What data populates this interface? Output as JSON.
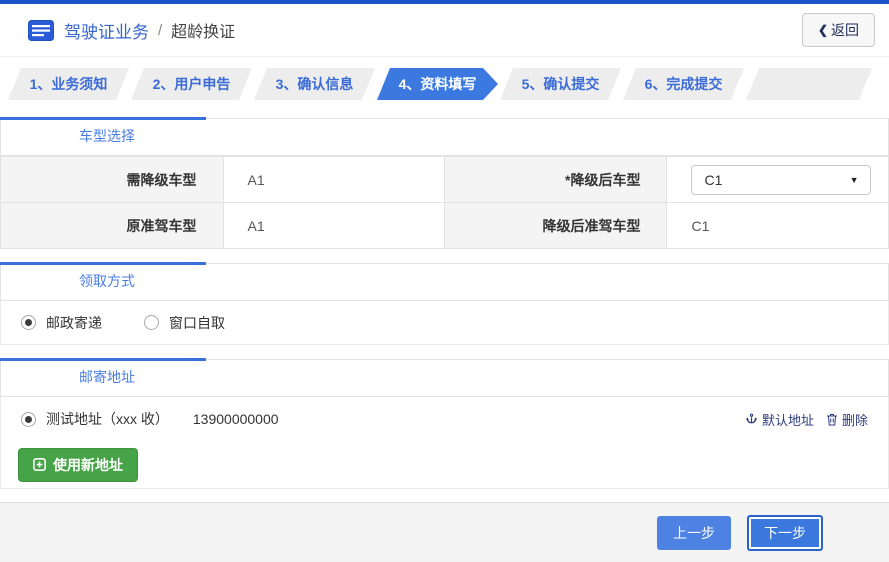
{
  "header": {
    "title": "驾驶证业务",
    "separator": "/",
    "subtitle": "超龄换证",
    "back": {
      "chevron": "❮",
      "label": "返回"
    }
  },
  "steps": [
    {
      "label": "1、业务须知",
      "active": false
    },
    {
      "label": "2、用户申告",
      "active": false
    },
    {
      "label": "3、确认信息",
      "active": false
    },
    {
      "label": "4、资料填写",
      "active": true
    },
    {
      "label": "5、确认提交",
      "active": false
    },
    {
      "label": "6、完成提交",
      "active": false
    }
  ],
  "vehicle_section": {
    "title": "车型选择",
    "row1": {
      "label1": "需降级车型",
      "value1": "A1",
      "label2": "*降级后车型",
      "select": {
        "value": "C1",
        "arrow": "▼"
      }
    },
    "row2": {
      "label1": "原准驾车型",
      "value1": "A1",
      "label2": "降级后准驾车型",
      "value2": "C1"
    }
  },
  "pickup_section": {
    "title": "领取方式",
    "options": [
      {
        "label": "邮政寄递",
        "selected": true
      },
      {
        "label": "窗口自取",
        "selected": false
      }
    ]
  },
  "address_section": {
    "title": "邮寄地址",
    "address": {
      "selected": true,
      "name": "测试地址（xxx 收）",
      "phone": "13900000000"
    },
    "links": {
      "default_label": "默认地址",
      "delete_label": "删除"
    },
    "new_address_label": "使用新地址"
  },
  "footer": {
    "prev_label": "上一步",
    "next_label": "下一步"
  },
  "colors": {
    "topbar_blue": "#1d53c6",
    "step_active_blue": "#3b79e1",
    "step_text_blue": "#3a6bd8",
    "section_accent_blue": "#3a70dd",
    "section_title_blue": "#4a7de0",
    "link_navy": "#2a3b7e",
    "button_green": "#47a347",
    "footer_button_blue": "#3b78dd"
  }
}
